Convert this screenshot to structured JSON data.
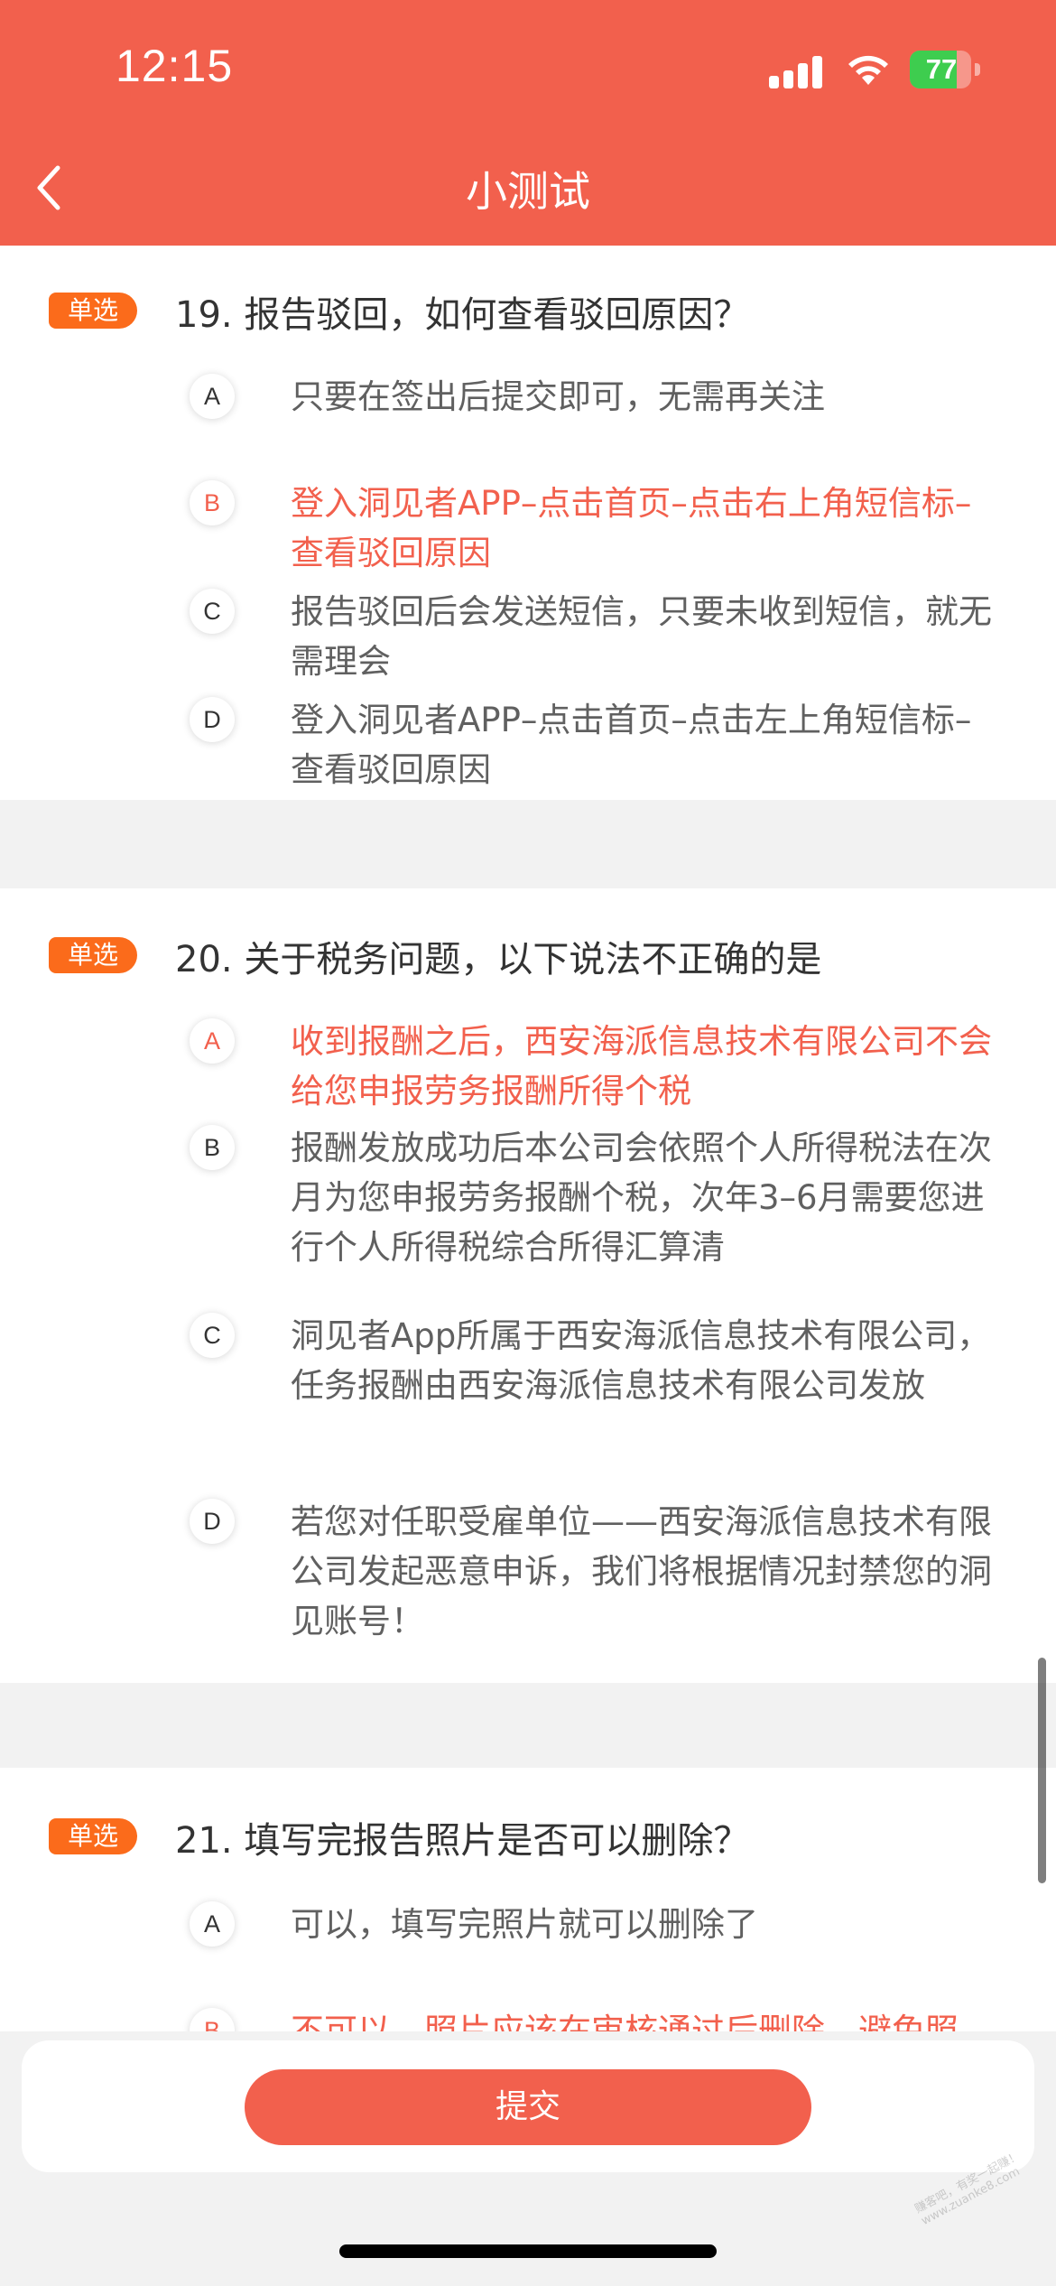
{
  "status_bar": {
    "time": "12:15",
    "battery_level": "77",
    "battery_fraction": 0.77
  },
  "nav": {
    "title": "小测试"
  },
  "questions": [
    {
      "tag": "单选",
      "question": "19. 报告驳回，如何查看驳回原因？",
      "options": [
        {
          "letter": "A",
          "text": "只要在签出后提交即可，无需再关注"
        },
        {
          "letter": "B",
          "text": "登入洞见者APP–点击首页–点击右上角短信标–查看驳回原因",
          "selected": true
        },
        {
          "letter": "C",
          "text": "报告驳回后会发送短信，只要未收到短信，就无需理会"
        },
        {
          "letter": "D",
          "text": "登入洞见者APP–点击首页–点击左上角短信标–查看驳回原因"
        }
      ]
    },
    {
      "tag": "单选",
      "question": "20. 关于税务问题，以下说法不正确的是",
      "options": [
        {
          "letter": "A",
          "text": "收到报酬之后，西安海派信息技术有限公司不会给您申报劳务报酬所得个税",
          "selected": true
        },
        {
          "letter": "B",
          "text": "报酬发放成功后本公司会依照个人所得税法在次月为您申报劳务报酬个税，次年3–6月需要您进行个人所得税综合所得汇算清"
        },
        {
          "letter": "C",
          "text": "洞见者App所属于西安海派信息技术有限公司，任务报酬由西安海派信息技术有限公司发放"
        },
        {
          "letter": "D",
          "text": "若您对任职受雇单位——西安海派信息技术有限公司发起恶意申诉，我们将根据情况封禁您的洞见账号！"
        }
      ]
    },
    {
      "tag": "单选",
      "question": "21. 填写完报告照片是否可以删除？",
      "options": [
        {
          "letter": "A",
          "text": "可以，填写完照片就可以删除了"
        },
        {
          "letter": "B",
          "text": "不可以，照片应该在审核通过后删除，避免照",
          "selected": true
        }
      ]
    }
  ],
  "footer": {
    "submit_label": "提交"
  },
  "watermark": "赚客吧，有奖一起赚！ www.zuanke8.com"
}
